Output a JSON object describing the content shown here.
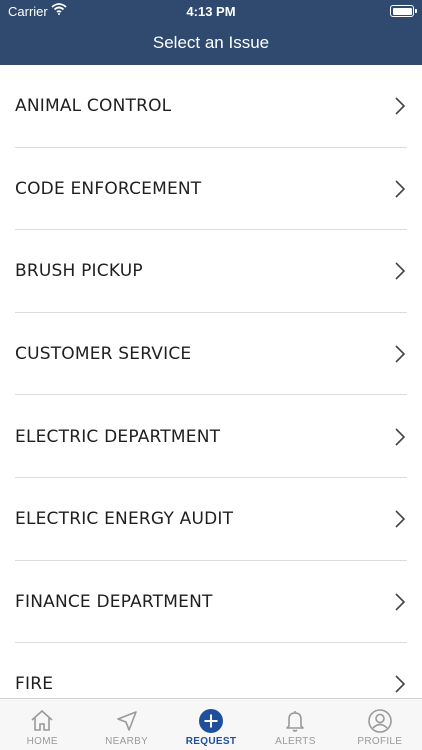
{
  "status_bar": {
    "carrier": "Carrier",
    "time": "4:13 PM"
  },
  "header": {
    "title": "Select an Issue"
  },
  "issues": [
    {
      "label": "ANIMAL CONTROL"
    },
    {
      "label": "CODE ENFORCEMENT"
    },
    {
      "label": "BRUSH PICKUP"
    },
    {
      "label": "CUSTOMER SERVICE"
    },
    {
      "label": "ELECTRIC DEPARTMENT"
    },
    {
      "label": "ELECTRIC ENERGY AUDIT"
    },
    {
      "label": "FINANCE DEPARTMENT"
    },
    {
      "label": "FIRE"
    }
  ],
  "tabs": [
    {
      "label": "HOME",
      "icon": "home-icon"
    },
    {
      "label": "NEARBY",
      "icon": "location-arrow-icon"
    },
    {
      "label": "REQUEST",
      "icon": "plus-circle-icon"
    },
    {
      "label": "ALERTS",
      "icon": "bell-icon"
    },
    {
      "label": "PROFILE",
      "icon": "user-circle-icon"
    }
  ],
  "colors": {
    "header_bg": "#2f4a6e",
    "active_tab": "#1f4f9c",
    "inactive_tab": "#9a9a9a"
  }
}
